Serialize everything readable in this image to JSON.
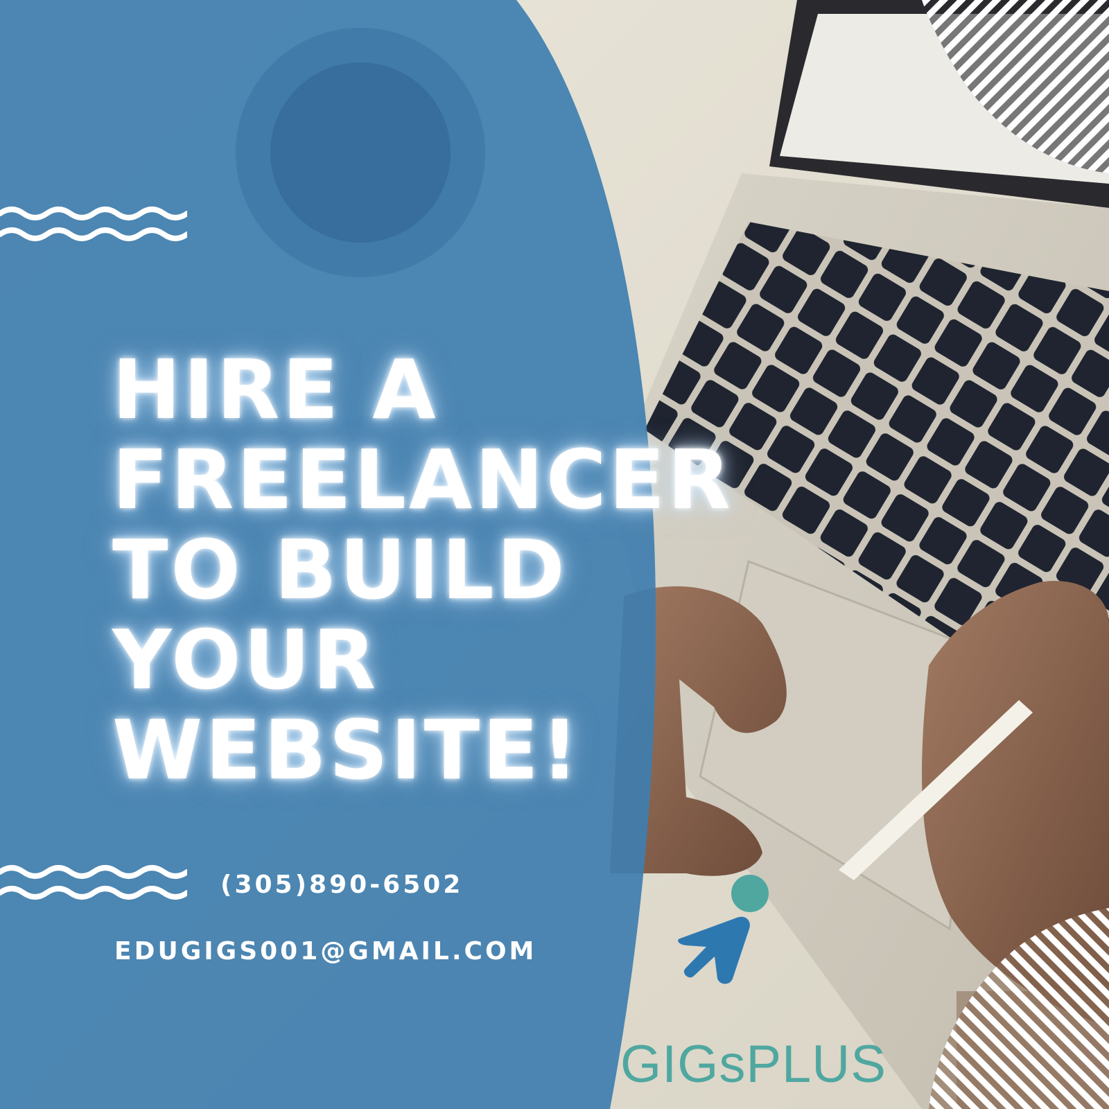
{
  "headline": {
    "lines": [
      "HIRE A",
      "FREELANCER",
      "TO BUILD",
      "YOUR",
      "WEBSITE!"
    ]
  },
  "contact": {
    "phone": "(305)890-6502",
    "email": "EDUGIGS001@GMAIL.COM"
  },
  "brand": {
    "name": "GIGsPLUS"
  },
  "colors": {
    "panel_blue": "#3f7eaf",
    "brand_teal": "#4fa7a0",
    "brand_arrow": "#2e78b0",
    "text": "#ffffff"
  },
  "icons": {
    "logo": "person-arrow-logo",
    "decoration": "wave-lines"
  }
}
